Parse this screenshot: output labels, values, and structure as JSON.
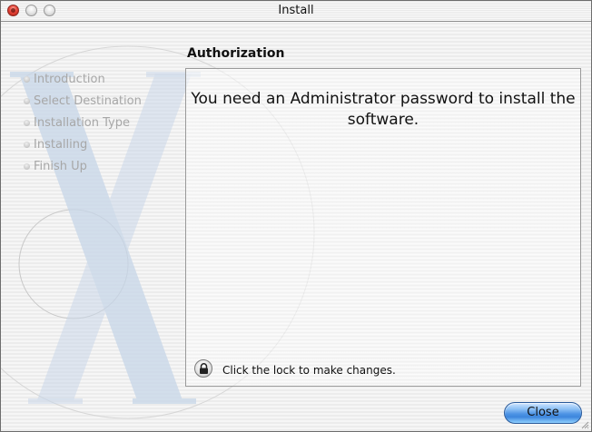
{
  "window": {
    "title": "Install"
  },
  "section_title": "Authorization",
  "steps": [
    {
      "label": "Introduction"
    },
    {
      "label": "Select Destination"
    },
    {
      "label": "Installation Type"
    },
    {
      "label": "Installing"
    },
    {
      "label": "Finish Up"
    }
  ],
  "content": {
    "message": "You need an Administrator password to install the software.",
    "lock_label": "Click the lock to make changes."
  },
  "buttons": {
    "close_label": "Close"
  },
  "colors": {
    "step_text": "#a7a7a7",
    "close_button_accent": "#4d93e4",
    "title_close_button": "#e8453a"
  },
  "icons": {
    "lock": "lock-icon",
    "watermark": "mac-os-x-logo"
  }
}
